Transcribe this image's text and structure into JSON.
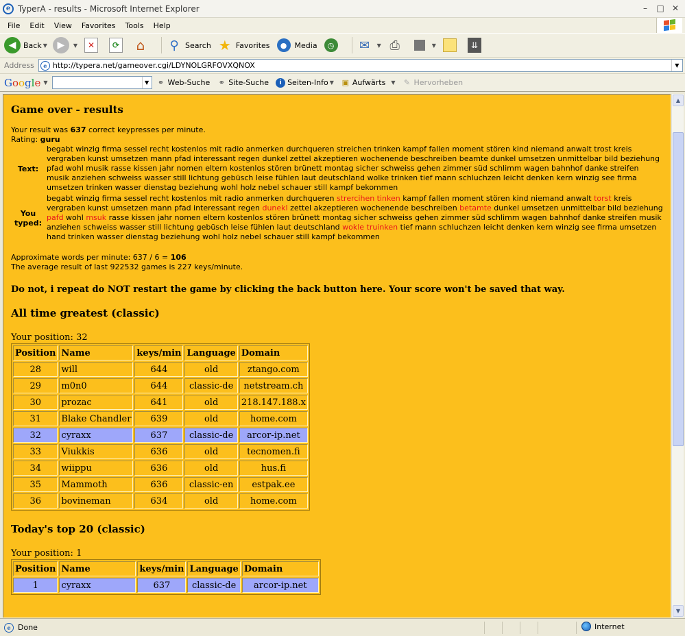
{
  "window": {
    "title": "TyperA - results - Microsoft Internet Explorer",
    "minimize": "–",
    "restore": "□",
    "close": "✕"
  },
  "menu": [
    "File",
    "Edit",
    "View",
    "Favorites",
    "Tools",
    "Help"
  ],
  "toolbar": {
    "back": "Back",
    "search": "Search",
    "favorites": "Favorites",
    "media": "Media"
  },
  "address": {
    "label": "Address",
    "url": "http://typera.net/gameover.cgi/LDYNOLGRFOVXQNOX"
  },
  "googlebar": {
    "search_value": "",
    "web_search": "Web-Suche",
    "site_search": "Site-Suche",
    "page_info": "Seiten-Info",
    "up": "Aufwärts",
    "highlight": "Hervorheben"
  },
  "page": {
    "title": "Game over - results",
    "result_prefix": "Your result was ",
    "result_value": "637",
    "result_suffix": " correct keypresses per minute.",
    "rating_label": "Rating: ",
    "rating_value": "guru",
    "text_label": "Text:",
    "text_body": "begabt winzig firma sessel recht kostenlos mit radio anmerken durchqueren streichen trinken kampf fallen moment stören kind niemand anwalt trost kreis vergraben kunst umsetzen mann pfad interessant regen dunkel zettel akzeptieren wochenende beschreiben beamte dunkel umsetzen unmittelbar bild beziehung pfad wohl musik rasse kissen jahr nomen eltern kostenlos stören brünett montag sicher schweiss gehen zimmer süd schlimm wagen bahnhof danke streifen musik anziehen schweiss wasser still lichtung gebüsch leise fühlen laut deutschland wolke trinken tief mann schluchzen leicht denken kern winzig see firma umsetzen trinken wasser dienstag beziehung wohl holz nebel schauer still kampf bekommen",
    "typed_label": "You typed:",
    "typed": {
      "t1": "begabt winzig firma sessel recht kostenlos mit radio anmerken durchqueren ",
      "e1": "strercihen tinken",
      "t2": " kampf fallen moment stören kind niemand anwalt ",
      "e2": "torst",
      "t3": " kreis vergraben kunst umsetzen mann pfad interessant regen ",
      "e3": "dunekl",
      "t4": " zettel akzeptieren wochenende beschreiben ",
      "e4": "betamte",
      "t5": " dunkel umsetzen unmittelbar bild beziehung ",
      "e5": "pafd",
      "t6": " wohl ",
      "e6": "msuk",
      "t7": " rasse kissen jahr nomen eltern kostenlos stören brünett montag sicher schweiss gehen zimmer süd schlimm wagen bahnhof danke streifen musik anziehen schweiss wasser still lichtung gebüsch leise fühlen laut deutschland ",
      "e7": "wokle truinken",
      "t8": " tief mann schluchzen leicht denken kern winzig see firma umsetzen hand trinken wasser dienstag beziehung wohl holz nebel schauer still kampf bekommen"
    },
    "wpm_prefix": "Approximate words per minute: 637 / 6 = ",
    "wpm_value": "106",
    "average": "The average result of last 922532 games is 227 keys/minute.",
    "warning": "Do not, i repeat do NOT restart the game by clicking the back button here. Your score won't be saved that way."
  },
  "alltime": {
    "title": "All time greatest (classic)",
    "position": "Your position: 32",
    "headers": [
      "Position",
      "Name",
      "keys/min",
      "Language",
      "Domain"
    ],
    "rows": [
      [
        "28",
        "will",
        "644",
        "old",
        "ztango.com"
      ],
      [
        "29",
        "m0n0",
        "644",
        "classic-de",
        "netstream.ch"
      ],
      [
        "30",
        "prozac",
        "641",
        "old",
        "218.147.188.x"
      ],
      [
        "31",
        "Blake Chandler",
        "639",
        "old",
        "home.com"
      ],
      [
        "32",
        "cyraxx",
        "637",
        "classic-de",
        "arcor-ip.net"
      ],
      [
        "33",
        "Viukkis",
        "636",
        "old",
        "tecnomen.fi"
      ],
      [
        "34",
        "wiippu",
        "636",
        "old",
        "hus.fi"
      ],
      [
        "35",
        "Mammoth",
        "636",
        "classic-en",
        "estpak.ee"
      ],
      [
        "36",
        "bovineman",
        "634",
        "old",
        "home.com"
      ]
    ]
  },
  "today": {
    "title": "Today's top 20 (classic)",
    "position": "Your position: 1",
    "headers": [
      "Position",
      "Name",
      "keys/min",
      "Language",
      "Domain"
    ],
    "rows": [
      [
        "1",
        "cyraxx",
        "637",
        "classic-de",
        "arcor-ip.net"
      ]
    ]
  },
  "status": {
    "text": "Done",
    "zone": "Internet"
  }
}
